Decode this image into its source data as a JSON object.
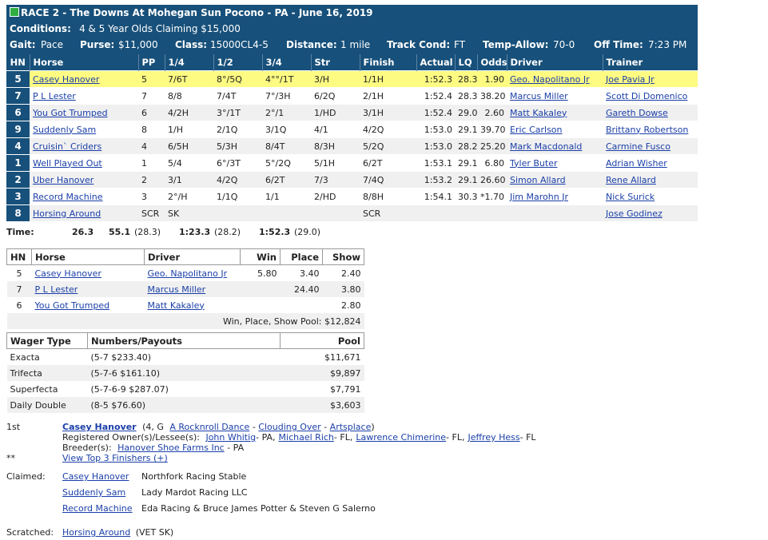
{
  "header": {
    "race_label": "RACE 2 - The Downs At Mohegan Sun Pocono - PA - June 16, 2019",
    "conditions_label": "Conditions:",
    "conditions_value": "4 & 5 Year Olds Claiming $15,000",
    "gait_label": "Gait:",
    "gait_value": "Pace",
    "purse_label": "Purse:",
    "purse_value": "$11,000",
    "class_label": "Class:",
    "class_value": "15000CL4-5",
    "distance_label": "Distance:",
    "distance_value": "1 mile",
    "track_label": "Track Cond:",
    "track_value": "FT",
    "temp_label": "Temp-Allow:",
    "temp_value": "70-0",
    "off_label": "Off Time:",
    "off_value": "7:23 PM"
  },
  "results": {
    "columns": [
      "HN",
      "Horse",
      "PP",
      "1/4",
      "1/2",
      "3/4",
      "Str",
      "Finish",
      "Actual",
      "LQ",
      "Odds",
      "Driver",
      "Trainer"
    ],
    "rows": [
      {
        "hn": "5",
        "horse": "Casey Hanover",
        "pp": "5",
        "q1": "7/6T",
        "q2": "8°/5Q",
        "q3": "4°°/1T",
        "str": "3/H",
        "fin": "1/1H",
        "actual": "1:52.3",
        "lq": "28.3",
        "odds": "1.90",
        "driver": "Geo. Napolitano Jr",
        "trainer": "Joe Pavia Jr"
      },
      {
        "hn": "7",
        "horse": "P L Lester",
        "pp": "7",
        "q1": "8/8",
        "q2": "7/4T",
        "q3": "7°/3H",
        "str": "6/2Q",
        "fin": "2/1H",
        "actual": "1:52.4",
        "lq": "28.3",
        "odds": "38.20",
        "driver": "Marcus Miller",
        "trainer": "Scott Di Domenico"
      },
      {
        "hn": "6",
        "horse": "You Got Trumped",
        "pp": "6",
        "q1": "4/2H",
        "q2": "3°/1T",
        "q3": "2°/1",
        "str": "1/HD",
        "fin": "3/1H",
        "actual": "1:52.4",
        "lq": "29.0",
        "odds": "2.60",
        "driver": "Matt Kakaley",
        "trainer": "Gareth Dowse"
      },
      {
        "hn": "9",
        "horse": "Suddenly Sam",
        "pp": "8",
        "q1": "1/H",
        "q2": "2/1Q",
        "q3": "3/1Q",
        "str": "4/1",
        "fin": "4/2Q",
        "actual": "1:53.0",
        "lq": "29.1",
        "odds": "39.70",
        "driver": "Eric Carlson",
        "trainer": "Brittany Robertson"
      },
      {
        "hn": "4",
        "horse": "Cruisin` Criders",
        "pp": "4",
        "q1": "6/5H",
        "q2": "5/3H",
        "q3": "8/4T",
        "str": "8/3H",
        "fin": "5/2Q",
        "actual": "1:53.0",
        "lq": "28.2",
        "odds": "25.20",
        "driver": "Mark Macdonald",
        "trainer": "Carmine Fusco"
      },
      {
        "hn": "1",
        "horse": "Well Played Out",
        "pp": "1",
        "q1": "5/4",
        "q2": "6°/3T",
        "q3": "5°/2Q",
        "str": "5/1H",
        "fin": "6/2T",
        "actual": "1:53.1",
        "lq": "29.1",
        "odds": "6.80",
        "driver": "Tyler Buter",
        "trainer": "Adrian Wisher"
      },
      {
        "hn": "2",
        "horse": "Uber Hanover",
        "pp": "2",
        "q1": "3/1",
        "q2": "4/2Q",
        "q3": "6/2T",
        "str": "7/3",
        "fin": "7/4Q",
        "actual": "1:53.2",
        "lq": "29.1",
        "odds": "26.60",
        "driver": "Simon Allard",
        "trainer": "Rene Allard"
      },
      {
        "hn": "3",
        "horse": "Record Machine",
        "pp": "3",
        "q1": "2°/H",
        "q2": "1/1Q",
        "q3": "1/1",
        "str": "2/HD",
        "fin": "8/8H",
        "actual": "1:54.1",
        "lq": "30.3",
        "odds": "*1.70",
        "driver": "Jim Marohn Jr",
        "trainer": "Nick Surick"
      },
      {
        "hn": "8",
        "horse": "Horsing Around",
        "pp": "SCR",
        "q1": "SK",
        "q2": "",
        "q3": "",
        "str": "",
        "fin": "SCR",
        "actual": "",
        "lq": "",
        "odds": "",
        "driver": "",
        "trainer": "Jose Godinez"
      }
    ]
  },
  "time": {
    "label": "Time:",
    "q1": "26.3",
    "q2": "55.1",
    "q2_split": "(28.3)",
    "q3": "1:23.3",
    "q3_split": "(28.2)",
    "final": "1:52.3",
    "final_split": "(29.0)"
  },
  "payouts": {
    "columns": [
      "HN",
      "Horse",
      "Driver",
      "Win",
      "Place",
      "Show"
    ],
    "rows": [
      {
        "hn": "5",
        "horse": "Casey Hanover",
        "driver": "Geo. Napolitano Jr",
        "win": "5.80",
        "place": "3.40",
        "show": "2.40"
      },
      {
        "hn": "7",
        "horse": "P L Lester",
        "driver": "Marcus Miller",
        "win": "",
        "place": "24.40",
        "show": "3.80"
      },
      {
        "hn": "6",
        "horse": "You Got Trumped",
        "driver": "Matt Kakaley",
        "win": "",
        "place": "",
        "show": "2.80"
      }
    ],
    "pool": "Win, Place, Show Pool: $12,824"
  },
  "wagers": {
    "columns": [
      "Wager Type",
      "Numbers/Payouts",
      "Pool"
    ],
    "rows": [
      {
        "type": "Exacta",
        "numbers": "(5-7 $233.40)",
        "pool": "$11,671"
      },
      {
        "type": "Trifecta",
        "numbers": "(5-7-6 $161.10)",
        "pool": "$9,897"
      },
      {
        "type": "Superfecta",
        "numbers": "(5-7-6-9 $287.07)",
        "pool": "$7,791"
      },
      {
        "type": "Daily Double",
        "numbers": "(8-5 $76.60)",
        "pool": "$3,603"
      }
    ]
  },
  "winner": {
    "place": "1st",
    "horse": "Casey Hanover",
    "age_sex": "(4, G",
    "sire": "A Rocknroll Dance",
    "dam": "Clouding Over",
    "damsire": "Artsplace",
    "sep1": "-",
    "sep2": "-",
    "close_paren": ")",
    "owner_label": "Registered Owner(s)/Lessee(s):",
    "owners": [
      {
        "name": "John Whitig",
        "loc": "- PA,"
      },
      {
        "name": "Michael Rich",
        "loc": "- FL,"
      },
      {
        "name": "Lawrence Chimerine",
        "loc": "- FL,"
      },
      {
        "name": "Jeffrey Hess",
        "loc": "- FL"
      }
    ],
    "breeder_label": "Breeder(s):",
    "breeder": "Hanover Shoe Farms Inc",
    "breeder_loc": "- PA",
    "stars": "**",
    "top3_link": "View Top 3 Finishers (+)"
  },
  "claimed": {
    "label": "Claimed:",
    "rows": [
      {
        "horse": "Casey Hanover",
        "by": "Northfork Racing Stable"
      },
      {
        "horse": "Suddenly Sam",
        "by": "Lady Mardot Racing LLC"
      },
      {
        "horse": "Record Machine",
        "by": "Eda Racing & Bruce James Potter & Steven G Salerno"
      }
    ]
  },
  "scratched": {
    "label": "Scratched:",
    "horse": "Horsing Around",
    "reason": "(VET SK)"
  },
  "colors": {
    "header_bg": "#17507a",
    "winner_row": "#fdfb82",
    "link": "#1a3fa8",
    "badge_green": "#2fae42"
  }
}
